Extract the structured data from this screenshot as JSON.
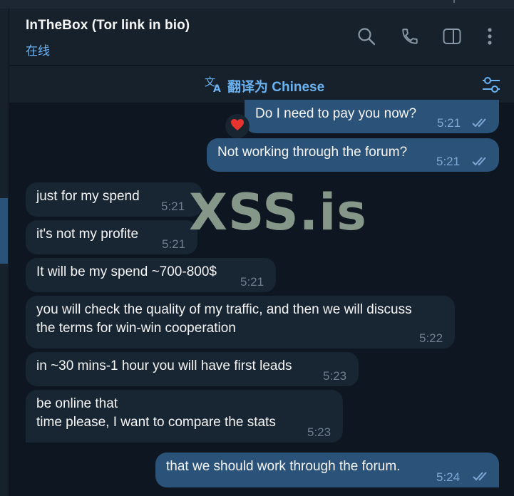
{
  "header": {
    "title": "InTheBox (Tor link in bio)",
    "status": "在线",
    "icons": [
      "search-icon",
      "phone-icon",
      "sidebar-toggle-icon",
      "more-vert-icon"
    ]
  },
  "translate_bar": {
    "label": "翻译为 Chinese",
    "icon": "translate-icon",
    "settings_icon": "filter-settings-icon"
  },
  "watermark": "XSS.is",
  "messages": [
    {
      "dir": "out",
      "text": "Do I need to pay you now?",
      "time": "5:21",
      "read": true,
      "reaction": "❤️"
    },
    {
      "dir": "out",
      "text": "Not working through the forum?",
      "time": "5:21",
      "read": true
    },
    {
      "dir": "in",
      "text": "just for my spend",
      "time": "5:21"
    },
    {
      "dir": "in",
      "text": "it's not my profite",
      "time": "5:21"
    },
    {
      "dir": "in",
      "text": "It will be my spend ~700-800$",
      "time": "5:21"
    },
    {
      "dir": "in",
      "line1": "you will check the quality of my traffic, and then we will discuss",
      "line2": "the terms for win-win cooperation",
      "time": "5:22"
    },
    {
      "dir": "in",
      "text": "in ~30 mins-1 hour you will have first leads",
      "time": "5:23"
    },
    {
      "dir": "in",
      "line1": "be online that",
      "line2": "time please, I want to compare the stats",
      "time": "5:23"
    },
    {
      "dir": "out",
      "text": "that we should work through the forum.",
      "time": "5:24",
      "read": true
    }
  ],
  "colors": {
    "background": "#0e1621",
    "panel": "#17212b",
    "incoming_bubble": "#182533",
    "outgoing_bubble": "#2b5278",
    "accent": "#6ab2f2"
  }
}
